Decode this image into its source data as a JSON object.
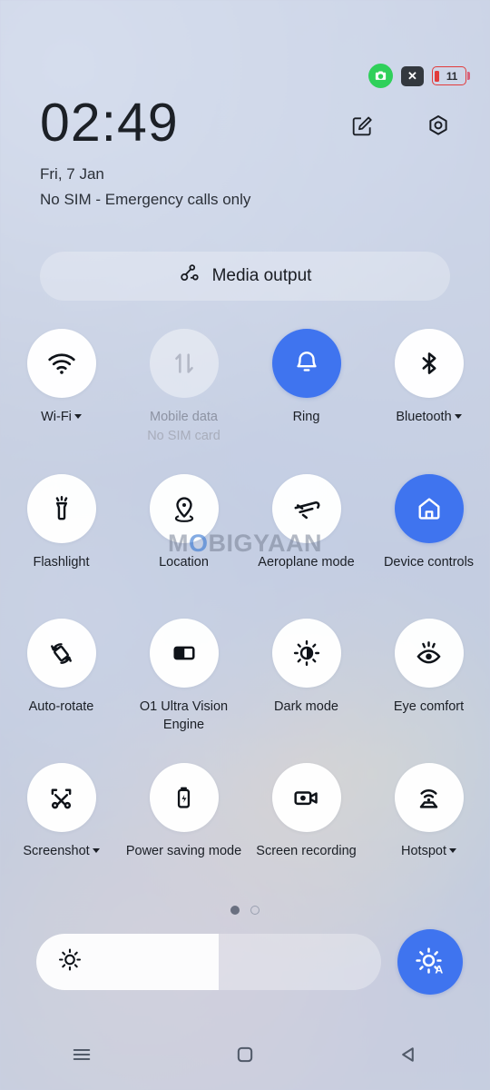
{
  "statusbar": {
    "screenshot_icon": "camera-green-badge",
    "close_icon": "x-badge",
    "battery_percent": "11",
    "battery_color": "#e23b3b"
  },
  "header": {
    "time": "02:49",
    "date": "Fri, 7 Jan",
    "carrier": "No SIM - Emergency calls only",
    "edit_icon": "edit-square-pencil-icon",
    "settings_icon": "hexagon-gear-icon"
  },
  "media_output": {
    "label": "Media output",
    "icon": "cast-share-icon"
  },
  "tiles": [
    [
      {
        "label": "Wi-Fi",
        "icon": "wifi-icon",
        "state": "default",
        "caret": true
      },
      {
        "label": "Mobile data",
        "sub": "No SIM card",
        "icon": "mobile-data-arrows-icon",
        "state": "disabled",
        "caret": false
      },
      {
        "label": "Ring",
        "icon": "bell-icon",
        "state": "active",
        "caret": false
      },
      {
        "label": "Bluetooth",
        "icon": "bluetooth-icon",
        "state": "default",
        "caret": true
      }
    ],
    [
      {
        "label": "Flashlight",
        "icon": "flashlight-icon",
        "state": "default",
        "caret": false
      },
      {
        "label": "Location",
        "icon": "location-pin-icon",
        "state": "default",
        "caret": false
      },
      {
        "label": "Aeroplane mode",
        "icon": "airplane-icon",
        "state": "default",
        "caret": false
      },
      {
        "label": "Device controls",
        "icon": "home-icon",
        "state": "active",
        "caret": false
      }
    ],
    [
      {
        "label": "Auto-rotate",
        "icon": "auto-rotate-icon",
        "state": "default",
        "caret": false
      },
      {
        "label": "O1 Ultra Vision Engine",
        "icon": "vision-engine-icon",
        "state": "default",
        "caret": false
      },
      {
        "label": "Dark mode",
        "icon": "dark-mode-icon",
        "state": "default",
        "caret": false
      },
      {
        "label": "Eye comfort",
        "icon": "eye-comfort-icon",
        "state": "default",
        "caret": false
      }
    ],
    [
      {
        "label": "Screenshot",
        "icon": "screenshot-scissors-icon",
        "state": "default",
        "caret": true
      },
      {
        "label": "Power saving mode",
        "icon": "battery-bolt-icon",
        "state": "default",
        "caret": false
      },
      {
        "label": "Screen recording",
        "icon": "video-camera-icon",
        "state": "default",
        "caret": false
      },
      {
        "label": "Hotspot",
        "icon": "hotspot-icon",
        "state": "default",
        "caret": true
      }
    ]
  ],
  "pager": {
    "pages": 2,
    "current": 1
  },
  "brightness": {
    "value_percent": 53,
    "slider_icon": "sun-brightness-icon",
    "auto_button_icon": "sun-auto-icon",
    "auto_enabled": true,
    "auto_letter": "A"
  },
  "navbar": {
    "recents_icon": "recents-menu-icon",
    "home_icon": "home-square-icon",
    "back_icon": "back-triangle-icon"
  },
  "watermark": {
    "before": "M",
    "o": "O",
    "after": "BIGYAAN"
  },
  "colors": {
    "accent_blue": "#3f74ef",
    "background": "#c9d0e1",
    "text": "#1b1f26",
    "disabled_text": "#8d93a3"
  }
}
